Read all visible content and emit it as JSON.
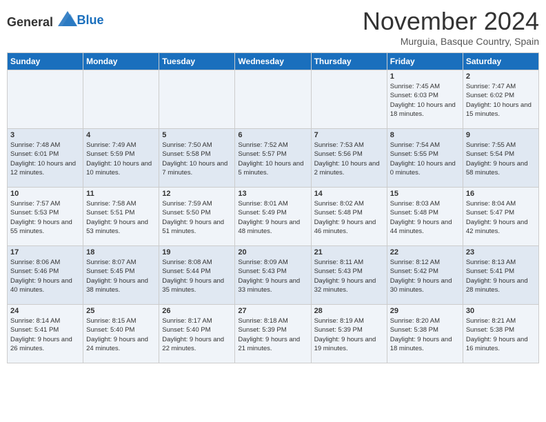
{
  "header": {
    "logo_general": "General",
    "logo_blue": "Blue",
    "month_title": "November 2024",
    "location": "Murguia, Basque Country, Spain"
  },
  "weekdays": [
    "Sunday",
    "Monday",
    "Tuesday",
    "Wednesday",
    "Thursday",
    "Friday",
    "Saturday"
  ],
  "weeks": [
    [
      {
        "day": "",
        "content": ""
      },
      {
        "day": "",
        "content": ""
      },
      {
        "day": "",
        "content": ""
      },
      {
        "day": "",
        "content": ""
      },
      {
        "day": "",
        "content": ""
      },
      {
        "day": "1",
        "content": "Sunrise: 7:45 AM\nSunset: 6:03 PM\nDaylight: 10 hours and 18 minutes."
      },
      {
        "day": "2",
        "content": "Sunrise: 7:47 AM\nSunset: 6:02 PM\nDaylight: 10 hours and 15 minutes."
      }
    ],
    [
      {
        "day": "3",
        "content": "Sunrise: 7:48 AM\nSunset: 6:01 PM\nDaylight: 10 hours and 12 minutes."
      },
      {
        "day": "4",
        "content": "Sunrise: 7:49 AM\nSunset: 5:59 PM\nDaylight: 10 hours and 10 minutes."
      },
      {
        "day": "5",
        "content": "Sunrise: 7:50 AM\nSunset: 5:58 PM\nDaylight: 10 hours and 7 minutes."
      },
      {
        "day": "6",
        "content": "Sunrise: 7:52 AM\nSunset: 5:57 PM\nDaylight: 10 hours and 5 minutes."
      },
      {
        "day": "7",
        "content": "Sunrise: 7:53 AM\nSunset: 5:56 PM\nDaylight: 10 hours and 2 minutes."
      },
      {
        "day": "8",
        "content": "Sunrise: 7:54 AM\nSunset: 5:55 PM\nDaylight: 10 hours and 0 minutes."
      },
      {
        "day": "9",
        "content": "Sunrise: 7:55 AM\nSunset: 5:54 PM\nDaylight: 9 hours and 58 minutes."
      }
    ],
    [
      {
        "day": "10",
        "content": "Sunrise: 7:57 AM\nSunset: 5:53 PM\nDaylight: 9 hours and 55 minutes."
      },
      {
        "day": "11",
        "content": "Sunrise: 7:58 AM\nSunset: 5:51 PM\nDaylight: 9 hours and 53 minutes."
      },
      {
        "day": "12",
        "content": "Sunrise: 7:59 AM\nSunset: 5:50 PM\nDaylight: 9 hours and 51 minutes."
      },
      {
        "day": "13",
        "content": "Sunrise: 8:01 AM\nSunset: 5:49 PM\nDaylight: 9 hours and 48 minutes."
      },
      {
        "day": "14",
        "content": "Sunrise: 8:02 AM\nSunset: 5:48 PM\nDaylight: 9 hours and 46 minutes."
      },
      {
        "day": "15",
        "content": "Sunrise: 8:03 AM\nSunset: 5:48 PM\nDaylight: 9 hours and 44 minutes."
      },
      {
        "day": "16",
        "content": "Sunrise: 8:04 AM\nSunset: 5:47 PM\nDaylight: 9 hours and 42 minutes."
      }
    ],
    [
      {
        "day": "17",
        "content": "Sunrise: 8:06 AM\nSunset: 5:46 PM\nDaylight: 9 hours and 40 minutes."
      },
      {
        "day": "18",
        "content": "Sunrise: 8:07 AM\nSunset: 5:45 PM\nDaylight: 9 hours and 38 minutes."
      },
      {
        "day": "19",
        "content": "Sunrise: 8:08 AM\nSunset: 5:44 PM\nDaylight: 9 hours and 35 minutes."
      },
      {
        "day": "20",
        "content": "Sunrise: 8:09 AM\nSunset: 5:43 PM\nDaylight: 9 hours and 33 minutes."
      },
      {
        "day": "21",
        "content": "Sunrise: 8:11 AM\nSunset: 5:43 PM\nDaylight: 9 hours and 32 minutes."
      },
      {
        "day": "22",
        "content": "Sunrise: 8:12 AM\nSunset: 5:42 PM\nDaylight: 9 hours and 30 minutes."
      },
      {
        "day": "23",
        "content": "Sunrise: 8:13 AM\nSunset: 5:41 PM\nDaylight: 9 hours and 28 minutes."
      }
    ],
    [
      {
        "day": "24",
        "content": "Sunrise: 8:14 AM\nSunset: 5:41 PM\nDaylight: 9 hours and 26 minutes."
      },
      {
        "day": "25",
        "content": "Sunrise: 8:15 AM\nSunset: 5:40 PM\nDaylight: 9 hours and 24 minutes."
      },
      {
        "day": "26",
        "content": "Sunrise: 8:17 AM\nSunset: 5:40 PM\nDaylight: 9 hours and 22 minutes."
      },
      {
        "day": "27",
        "content": "Sunrise: 8:18 AM\nSunset: 5:39 PM\nDaylight: 9 hours and 21 minutes."
      },
      {
        "day": "28",
        "content": "Sunrise: 8:19 AM\nSunset: 5:39 PM\nDaylight: 9 hours and 19 minutes."
      },
      {
        "day": "29",
        "content": "Sunrise: 8:20 AM\nSunset: 5:38 PM\nDaylight: 9 hours and 18 minutes."
      },
      {
        "day": "30",
        "content": "Sunrise: 8:21 AM\nSunset: 5:38 PM\nDaylight: 9 hours and 16 minutes."
      }
    ]
  ]
}
